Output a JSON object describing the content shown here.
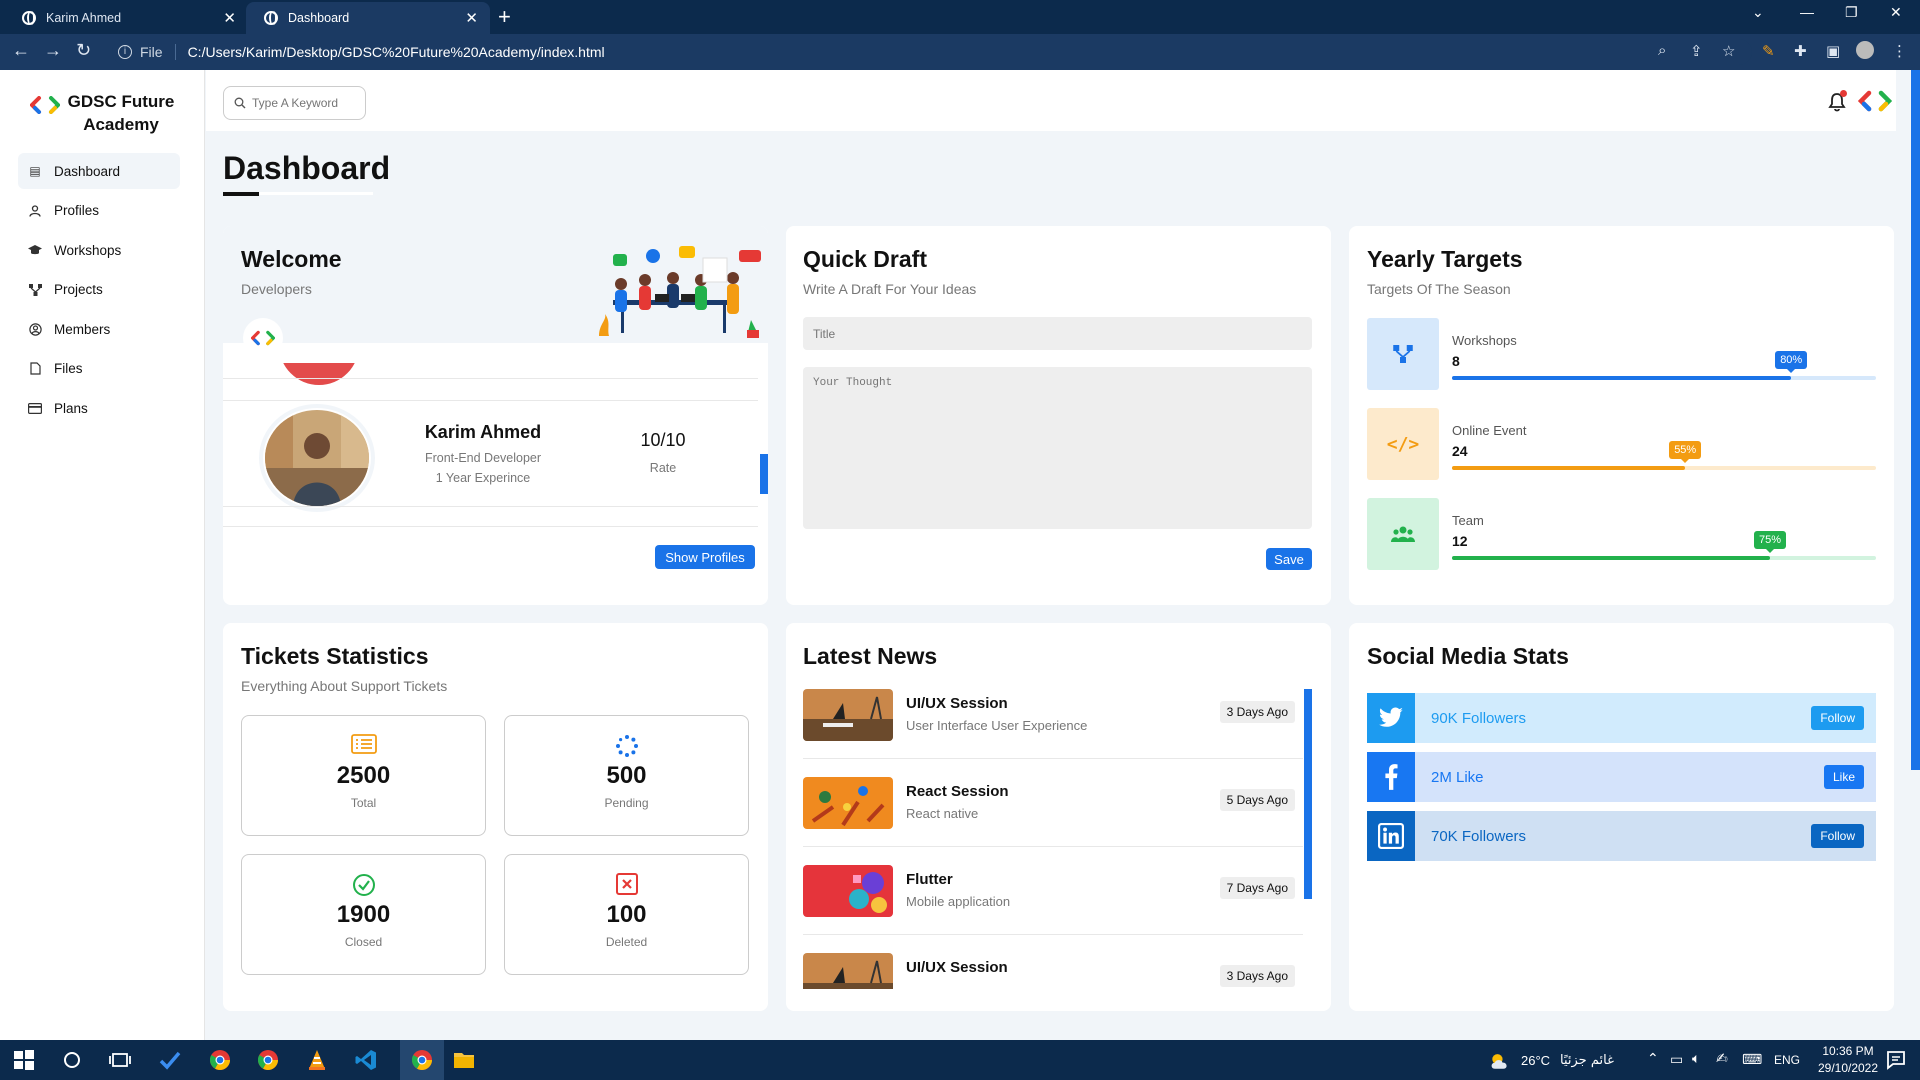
{
  "browser": {
    "tabs": [
      {
        "label": "Karim Ahmed"
      },
      {
        "label": "Dashboard"
      }
    ],
    "scheme": "File",
    "url": "C:/Users/Karim/Desktop/GDSC%20Future%20Academy/index.html"
  },
  "sidebar": {
    "brand": "GDSC Future Academy",
    "items": [
      {
        "label": "Dashboard",
        "icon": "chart-icon"
      },
      {
        "label": "Profiles",
        "icon": "user-icon"
      },
      {
        "label": "Workshops",
        "icon": "graduation-cap-icon"
      },
      {
        "label": "Projects",
        "icon": "diagram-icon"
      },
      {
        "label": "Members",
        "icon": "user-circle-icon"
      },
      {
        "label": "Files",
        "icon": "file-icon"
      },
      {
        "label": "Plans",
        "icon": "credit-card-icon"
      }
    ]
  },
  "header": {
    "search_placeholder": "Type A Keyword"
  },
  "page": {
    "title": "Dashboard"
  },
  "welcome": {
    "title": "Welcome",
    "subtitle": "Developers",
    "name": "Karim Ahmed",
    "role": "Front-End Developer",
    "experience": "1 Year Experince",
    "rate_value": "10/10",
    "rate_label": "Rate",
    "button": "Show Profiles"
  },
  "draft": {
    "title": "Quick Draft",
    "subtitle": "Write A Draft For Your Ideas",
    "title_placeholder": "Title",
    "text_placeholder": "Your Thought",
    "button": "Save"
  },
  "targets": {
    "title": "Yearly Targets",
    "subtitle": "Targets Of The Season",
    "items": [
      {
        "name": "Workshops",
        "value": "8",
        "percent_label": "80%",
        "percent": 80,
        "color": "#1a73e8",
        "track": "#d6e8fb",
        "icon_bg": "#d6e8fb",
        "icon": "diagram-icon"
      },
      {
        "name": "Online Event",
        "value": "24",
        "percent_label": "55%",
        "percent": 55,
        "color": "#f39c12",
        "track": "#fdeacc",
        "icon_bg": "#fdeacc",
        "icon": "code-icon"
      },
      {
        "name": "Team",
        "value": "12",
        "percent_label": "75%",
        "percent": 75,
        "color": "#22b14c",
        "track": "#d2f3df",
        "icon_bg": "#d2f3df",
        "icon": "users-icon"
      }
    ]
  },
  "tickets": {
    "title": "Tickets Statistics",
    "subtitle": "Everything About Support Tickets",
    "items": [
      {
        "value": "2500",
        "label": "Total",
        "icon": "list-icon",
        "color": "#f39c12"
      },
      {
        "value": "500",
        "label": "Pending",
        "icon": "spinner-icon",
        "color": "#1a73e8"
      },
      {
        "value": "1900",
        "label": "Closed",
        "icon": "check-circle-icon",
        "color": "#22b14c"
      },
      {
        "value": "100",
        "label": "Deleted",
        "icon": "x-square-icon",
        "color": "#e53935"
      }
    ]
  },
  "news": {
    "title": "Latest News",
    "items": [
      {
        "title": "UI/UX Session",
        "desc": "User Interface User Experience",
        "date": "3 Days Ago"
      },
      {
        "title": "React Session",
        "desc": "React native",
        "date": "5 Days Ago"
      },
      {
        "title": "Flutter",
        "desc": "Mobile application",
        "date": "7 Days Ago"
      },
      {
        "title": "UI/UX Session",
        "desc": "",
        "date": "3 Days Ago"
      }
    ]
  },
  "social": {
    "title": "Social Media Stats",
    "items": [
      {
        "text": "90K Followers",
        "button": "Follow",
        "icon": "twitter-icon",
        "icon_bg": "#1d9bf0",
        "bg": "#d1ebfd",
        "text_color": "#1d9bf0",
        "btn_bg": "#1d9bf0"
      },
      {
        "text": "2M Like",
        "button": "Like",
        "icon": "facebook-icon",
        "icon_bg": "#1877f2",
        "bg": "#d4e3fb",
        "text_color": "#1877f2",
        "btn_bg": "#1877f2"
      },
      {
        "text": "70K Followers",
        "button": "Follow",
        "icon": "linkedin-icon",
        "icon_bg": "#0a66c2",
        "bg": "#cfe0f3",
        "text_color": "#0a66c2",
        "btn_bg": "#0a66c2"
      }
    ]
  },
  "taskbar": {
    "weather": "26°C",
    "weather_text": "غائم جزئيًا",
    "lang": "ENG",
    "time": "10:36 PM",
    "date": "29/10/2022"
  }
}
